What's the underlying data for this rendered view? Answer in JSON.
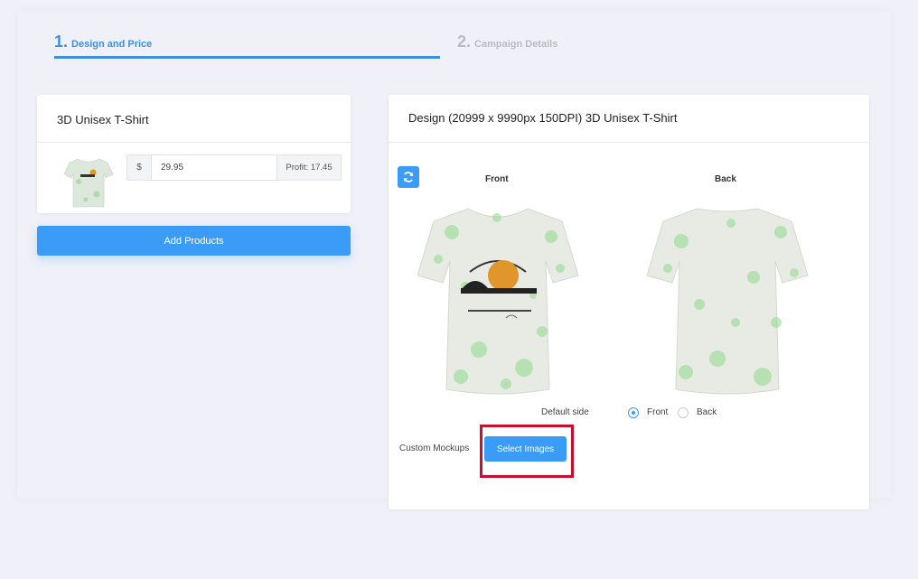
{
  "steps": [
    {
      "number": "1.",
      "label": "Design and Price"
    },
    {
      "number": "2.",
      "label": "Campaign Details"
    }
  ],
  "product": {
    "title": "3D Unisex T-Shirt",
    "currency_symbol": "$",
    "price": "29.95",
    "profit": "Profit: 17.45",
    "add_products_label": "Add Products"
  },
  "design": {
    "title": "Design (20999 x 9990px 150DPI) 3D Unisex T-Shirt",
    "front_label": "Front",
    "back_label": "Back",
    "default_side_label": "Default side",
    "radio_front_label": "Front",
    "radio_back_label": "Back",
    "selected_side": "Front",
    "custom_mockups_label": "Custom Mockups",
    "select_images_label": "Select Images"
  },
  "colors": {
    "accent": "#3a9cf7",
    "step_active": "#3f8fe0",
    "step_inactive": "#b8bbc6",
    "highlight": "#c8102e"
  }
}
